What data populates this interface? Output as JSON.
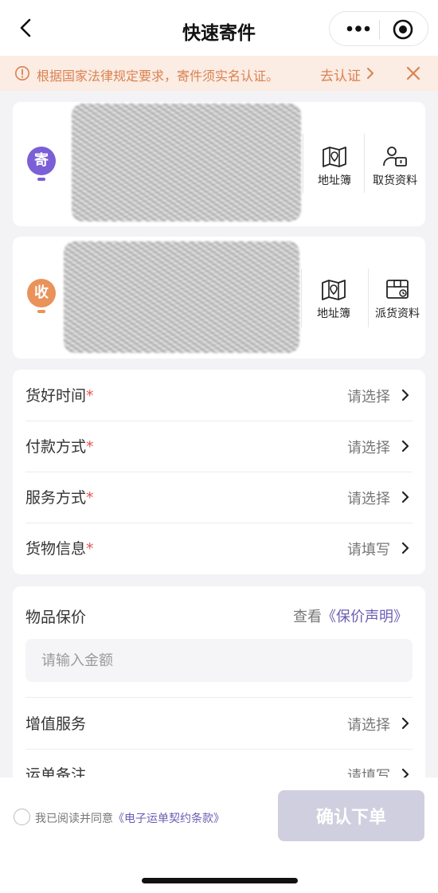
{
  "header": {
    "title": "快速寄件",
    "back_icon": "chevron-left-icon",
    "more_icon": "more-dots-icon",
    "target_icon": "record-target-icon"
  },
  "notice": {
    "text": "根据国家法律规定要求，寄件须实名认证。",
    "action_label": "去认证",
    "color": "#d9824f",
    "background": "#fbece4"
  },
  "sender": {
    "badge": "寄",
    "badge_color": "#7a5fd6",
    "actions": [
      {
        "label": "地址簿",
        "icon": "map-book-icon"
      },
      {
        "label": "取货资料",
        "icon": "courier-id-icon"
      }
    ]
  },
  "receiver": {
    "badge": "收",
    "badge_color": "#e9925a",
    "actions": [
      {
        "label": "地址簿",
        "icon": "map-book-icon"
      },
      {
        "label": "派货资料",
        "icon": "parcel-box-icon"
      }
    ]
  },
  "form": {
    "rows": [
      {
        "label": "货好时间",
        "required": "*",
        "value": "请选择"
      },
      {
        "label": "付款方式",
        "required": "*",
        "value": "请选择"
      },
      {
        "label": "服务方式",
        "required": "*",
        "value": "请选择"
      },
      {
        "label": "货物信息",
        "required": "*",
        "value": "请填写"
      }
    ]
  },
  "insurance": {
    "label": "物品保价",
    "link_prefix": "查看",
    "link_text": "《保价声明》",
    "amount_placeholder": "请输入金额"
  },
  "extra": {
    "rows": [
      {
        "label": "增值服务",
        "value": "请选择"
      },
      {
        "label": "运单备注",
        "value": "请填写"
      }
    ]
  },
  "footer": {
    "agree_text": "我已阅读并同意",
    "agree_link": "《电子运单契约条款》",
    "confirm_label": "确认下单",
    "accent": "#6a5db3"
  }
}
